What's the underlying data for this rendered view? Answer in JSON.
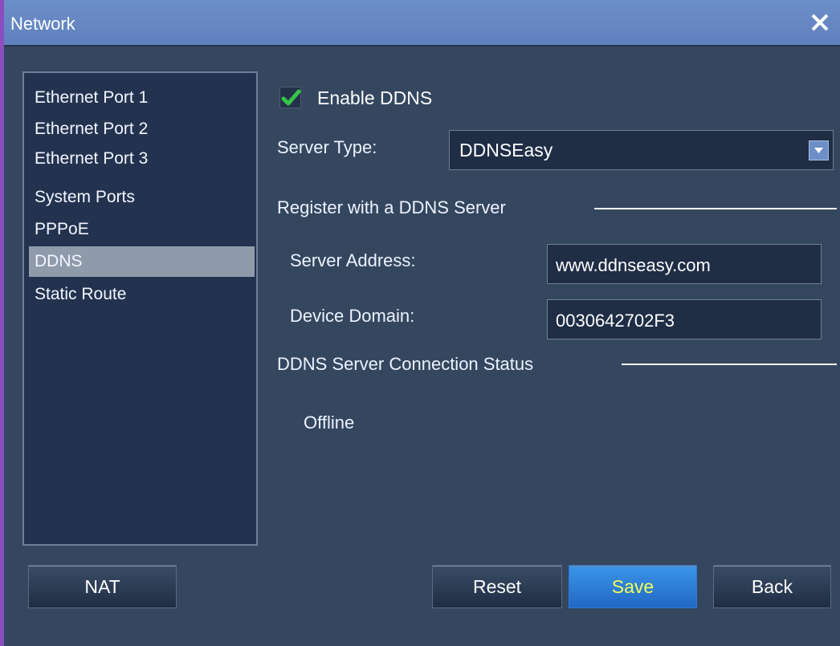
{
  "window": {
    "title": "Network"
  },
  "sidebar": {
    "items": [
      {
        "label": "Ethernet Port 1",
        "active": false
      },
      {
        "label": "Ethernet Port 2",
        "active": false
      },
      {
        "label": "Ethernet Port 3",
        "active": false
      },
      {
        "label": "System Ports",
        "active": false
      },
      {
        "label": "PPPoE",
        "active": false
      },
      {
        "label": "DDNS",
        "active": true
      },
      {
        "label": "Static Route",
        "active": false
      }
    ]
  },
  "ddns": {
    "enable_label": "Enable DDNS",
    "enable_checked": true,
    "server_type_label": "Server Type:",
    "server_type_value": "DDNSEasy",
    "register_section": "Register with a DDNS Server",
    "server_address_label": "Server Address:",
    "server_address_value": "www.ddnseasy.com",
    "device_domain_label": "Device Domain:",
    "device_domain_value": "0030642702F3",
    "status_section": "DDNS Server Connection Status",
    "status_value": "Offline"
  },
  "buttons": {
    "nat": "NAT",
    "reset": "Reset",
    "save": "Save",
    "back": "Back"
  },
  "colors": {
    "title_bar": "#6d8fc8",
    "panel_bg": "#34475f",
    "active_item": "#8f9bab",
    "save_text": "#f5ff58",
    "check_mark": "#36c54a"
  }
}
